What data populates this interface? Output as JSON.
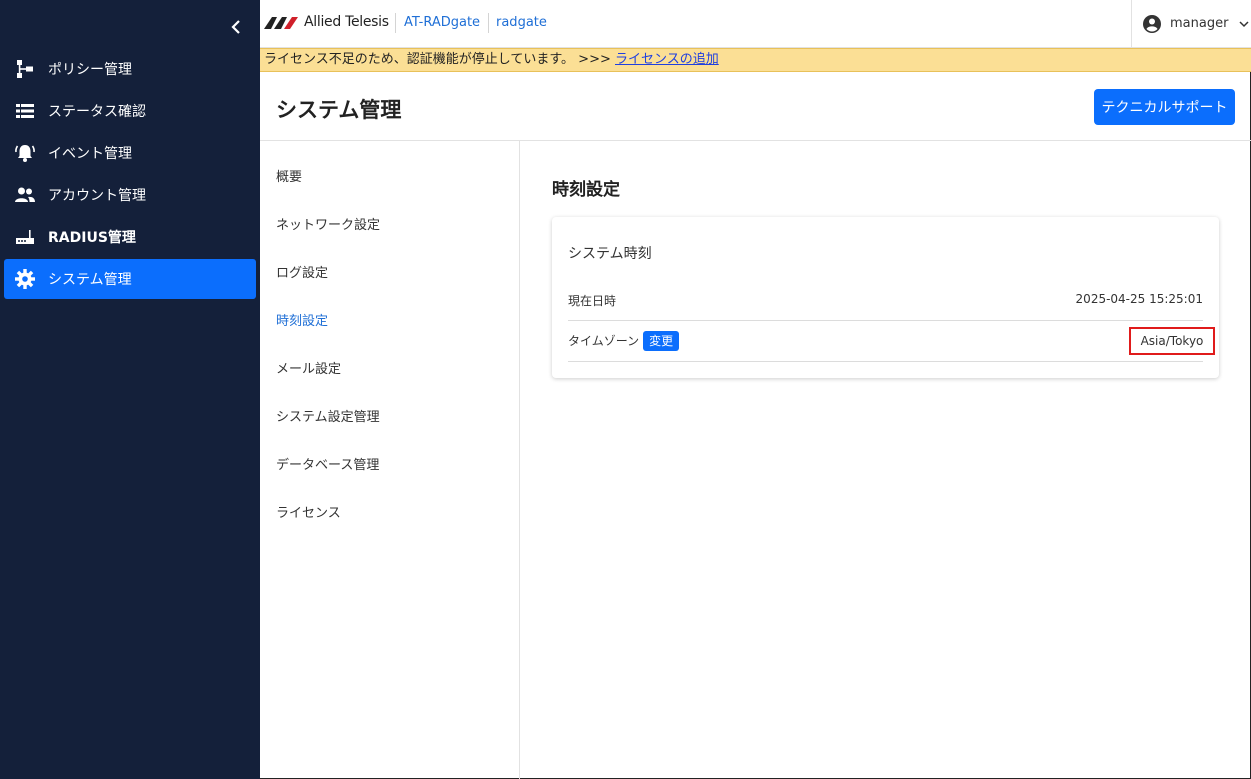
{
  "sidebar": {
    "items": [
      {
        "label": "ポリシー管理",
        "icon": "policy-tree-icon"
      },
      {
        "label": "ステータス確認",
        "icon": "list-icon"
      },
      {
        "label": "イベント管理",
        "icon": "alarm-icon"
      },
      {
        "label": "アカウント管理",
        "icon": "people-icon"
      },
      {
        "label": "RADIUS管理",
        "icon": "router-icon"
      },
      {
        "label": "システム管理",
        "icon": "gear-icon"
      }
    ],
    "active_index": 5
  },
  "header": {
    "logo_text": "Allied Telesis",
    "product": "AT-RADgate",
    "host": "radgate",
    "user": "manager"
  },
  "banner": {
    "text": "ライセンス不足のため、認証機能が停止しています。 >>> ",
    "link": "ライセンスの追加"
  },
  "page": {
    "title": "システム管理",
    "support_button": "テクニカルサポート"
  },
  "subnav": {
    "items": [
      "概要",
      "ネットワーク設定",
      "ログ設定",
      "時刻設定",
      "メール設定",
      "システム設定管理",
      "データベース管理",
      "ライセンス"
    ],
    "active_index": 3
  },
  "content": {
    "section_title": "時刻設定",
    "card_title": "システム時刻",
    "current_time_label": "現在日時",
    "current_time_value": "2025-04-25 15:25:01",
    "timezone_label": "タイムゾーン",
    "change_button": "変更",
    "timezone_value": "Asia/Tokyo"
  },
  "colors": {
    "sidebar_bg": "#14203a",
    "accent": "#0b6efd",
    "banner_bg": "#fbdf95",
    "highlight": "#e01b1b"
  }
}
